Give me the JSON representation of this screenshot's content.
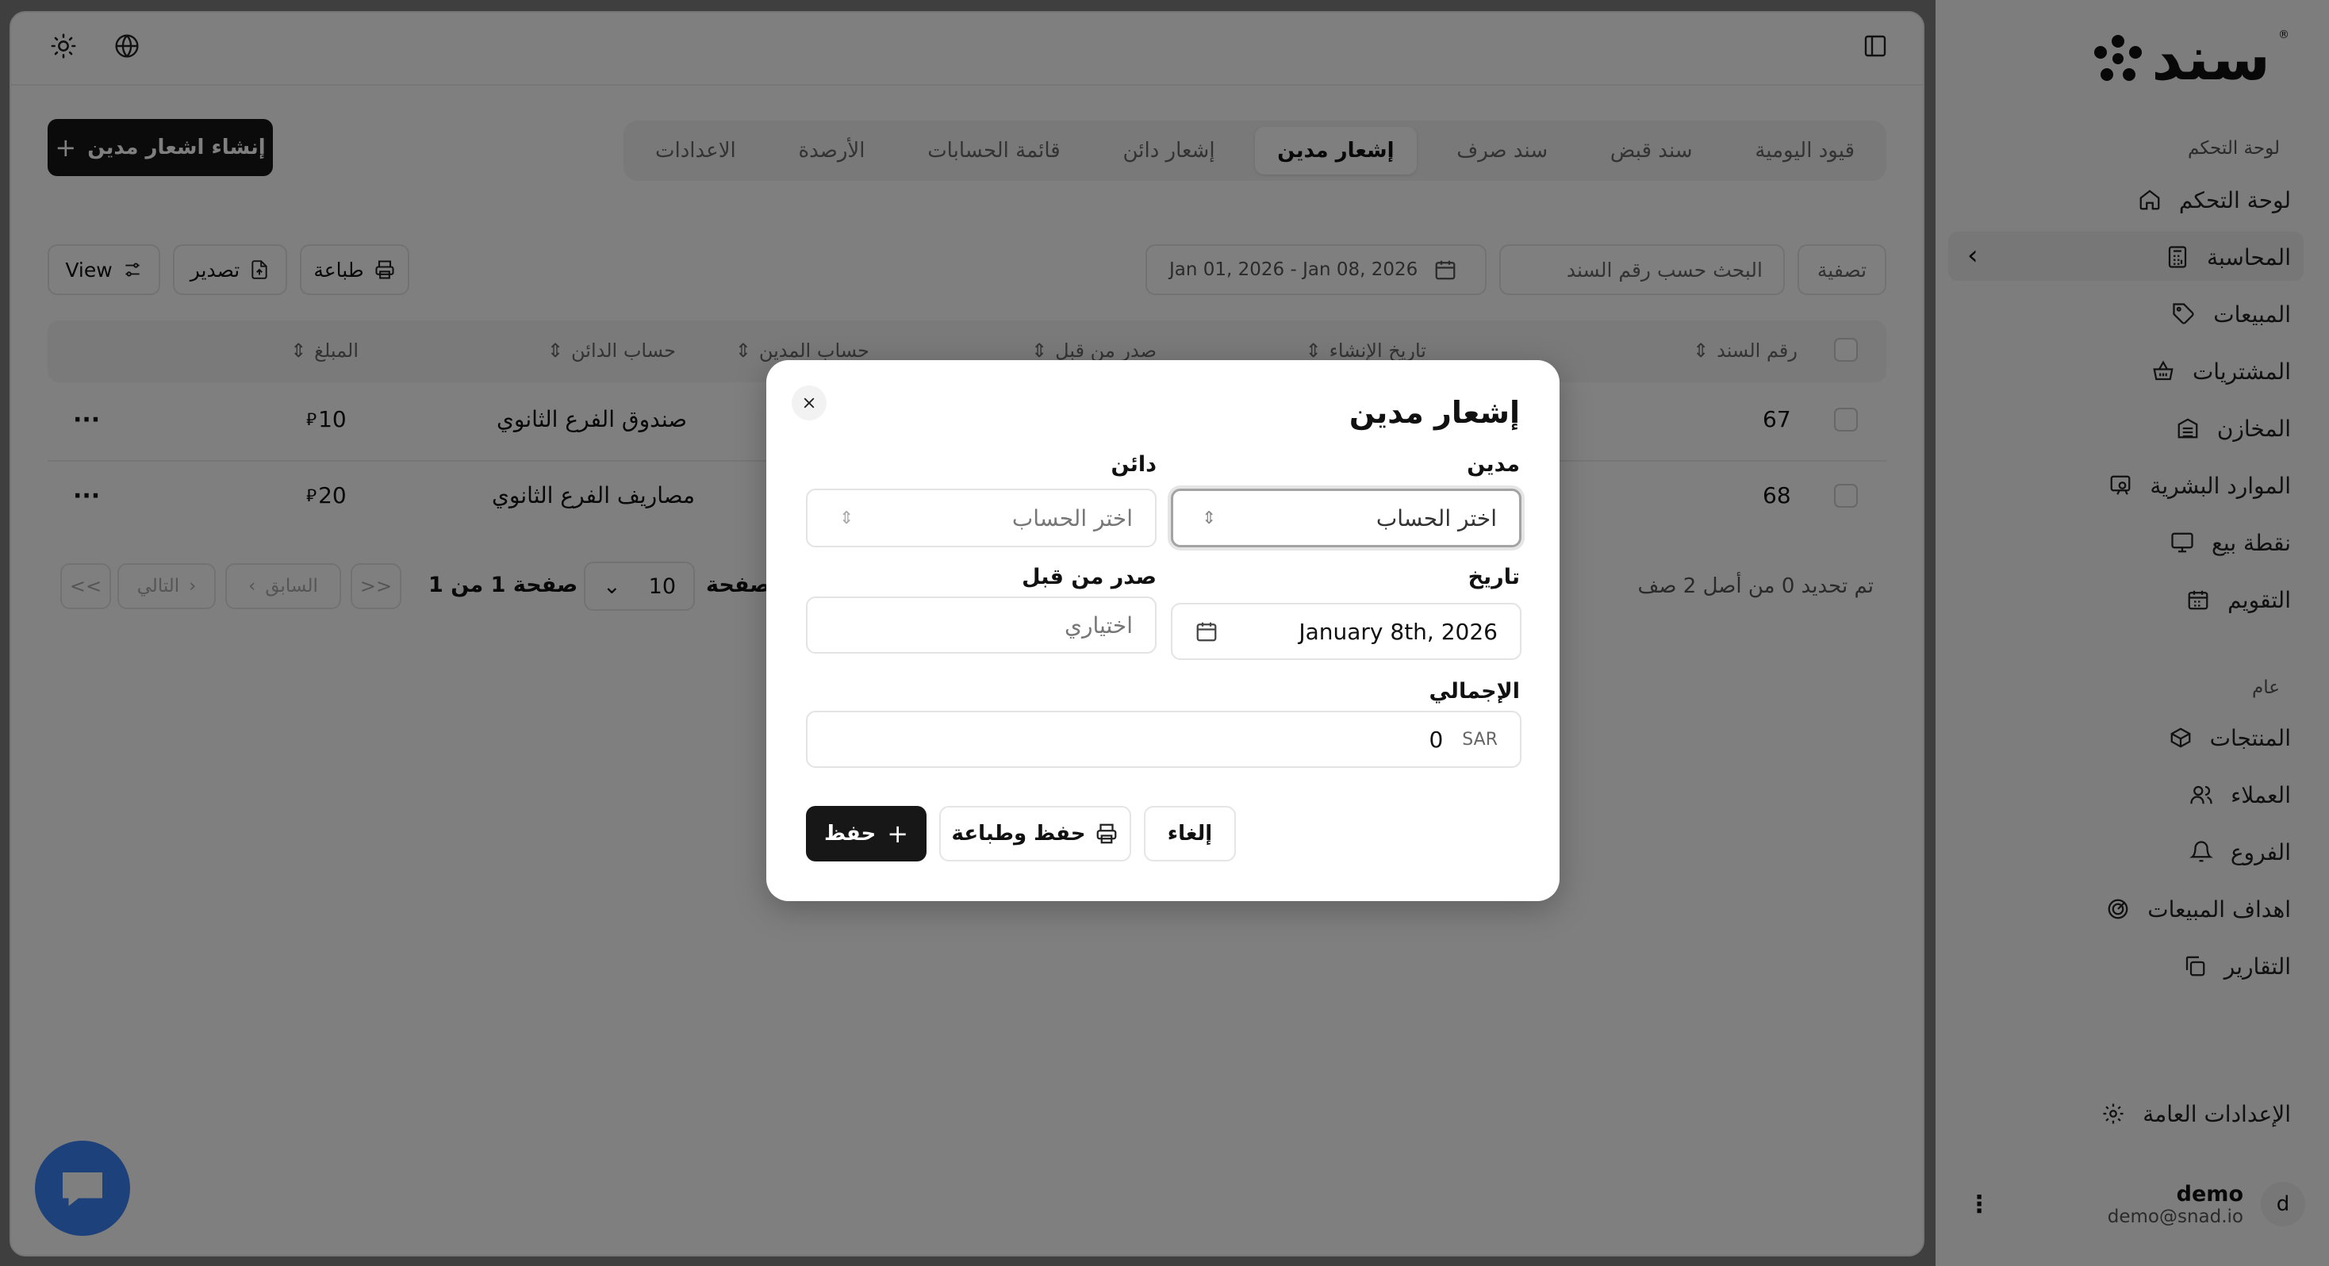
{
  "app": {
    "logo_text": "سند",
    "logo_registered": "®"
  },
  "topbar": {
    "sun_icon": "sun-icon",
    "globe_icon": "globe-icon",
    "sidebar_toggle_icon": "panel-icon"
  },
  "tabs": [
    {
      "label": "قيود اليومية",
      "active": false
    },
    {
      "label": "سند قبض",
      "active": false
    },
    {
      "label": "سند صرف",
      "active": false
    },
    {
      "label": "إشعار مدين",
      "active": true
    },
    {
      "label": "إشعار دائن",
      "active": false
    },
    {
      "label": "قائمة الحسابات",
      "active": false
    },
    {
      "label": "الأرصدة",
      "active": false
    },
    {
      "label": "الاعدادات",
      "active": false
    }
  ],
  "create_button": "إنشاء اشعار مدين",
  "toolbar": {
    "filter_label": "تصفية",
    "search_placeholder": "البحث حسب رقم السند",
    "date_range": "Jan 01, 2026 - Jan 08, 2026",
    "print_label": "طباعة",
    "export_label": "تصدير",
    "view_label": "View"
  },
  "table": {
    "columns": [
      "رقم السند",
      "تاريخ الإنشاء",
      "صدر من قبل",
      "حساب المدين",
      "حساب الدائن",
      "المبلغ"
    ],
    "rows": [
      {
        "number": "67",
        "credit_account": "صندوق الفرع الثانوي",
        "amount": "10",
        "currency": "⃁"
      },
      {
        "number": "68",
        "credit_account": "مصاريف الفرع الثانوي",
        "amount": "20",
        "currency": "⃁"
      }
    ]
  },
  "pagination": {
    "selection_text": "تم تحديد 0 من أصل 2 صف",
    "rows_label": "لصفحة",
    "rows_per_page": "10",
    "page_text": "صفحة 1 من 1",
    "prev_label": "السابق",
    "next_label": "التالي"
  },
  "sidebar": {
    "section_main": "لوحة التحكم",
    "items_main": [
      {
        "label": "لوحة التحكم",
        "icon": "home-icon"
      },
      {
        "label": "المحاسبة",
        "icon": "calculator-icon",
        "active": true
      },
      {
        "label": "المبيعات",
        "icon": "tag-icon"
      },
      {
        "label": "المشتريات",
        "icon": "basket-icon"
      },
      {
        "label": "المخازن",
        "icon": "warehouse-icon"
      },
      {
        "label": "الموارد البشرية",
        "icon": "users-board-icon"
      },
      {
        "label": "نقطة بيع",
        "icon": "monitor-icon"
      },
      {
        "label": "التقويم",
        "icon": "calendar-icon"
      }
    ],
    "section_general": "عام",
    "items_general": [
      {
        "label": "المنتجات",
        "icon": "box-icon"
      },
      {
        "label": "العملاء",
        "icon": "users-icon"
      },
      {
        "label": "الفروع",
        "icon": "bell-icon"
      },
      {
        "label": "اهداف المبيعات",
        "icon": "target-icon"
      },
      {
        "label": "التقارير",
        "icon": "copy-icon"
      }
    ],
    "settings_label": "الإعدادات العامة",
    "user": {
      "name": "demo",
      "email": "demo@snad.io",
      "avatar_letter": "d"
    }
  },
  "dialog": {
    "title": "إشعار مدين",
    "debit_label": "مدين",
    "debit_placeholder": "اختر الحساب",
    "credit_label": "دائن",
    "credit_placeholder": "اختر الحساب",
    "date_label": "تاريخ",
    "date_value": "January 8th, 2026",
    "issued_by_label": "صدر من قبل",
    "issued_by_placeholder": "اختياري",
    "total_label": "الإجمالي",
    "total_value": "0",
    "total_currency": "SAR",
    "save_label": "حفظ",
    "save_print_label": "حفظ وطباعة",
    "cancel_label": "إلغاء"
  },
  "colors": {
    "primary": "#171717",
    "chat_bubble": "#3b82f6",
    "overlay": "rgba(0,0,0,0.5)"
  }
}
